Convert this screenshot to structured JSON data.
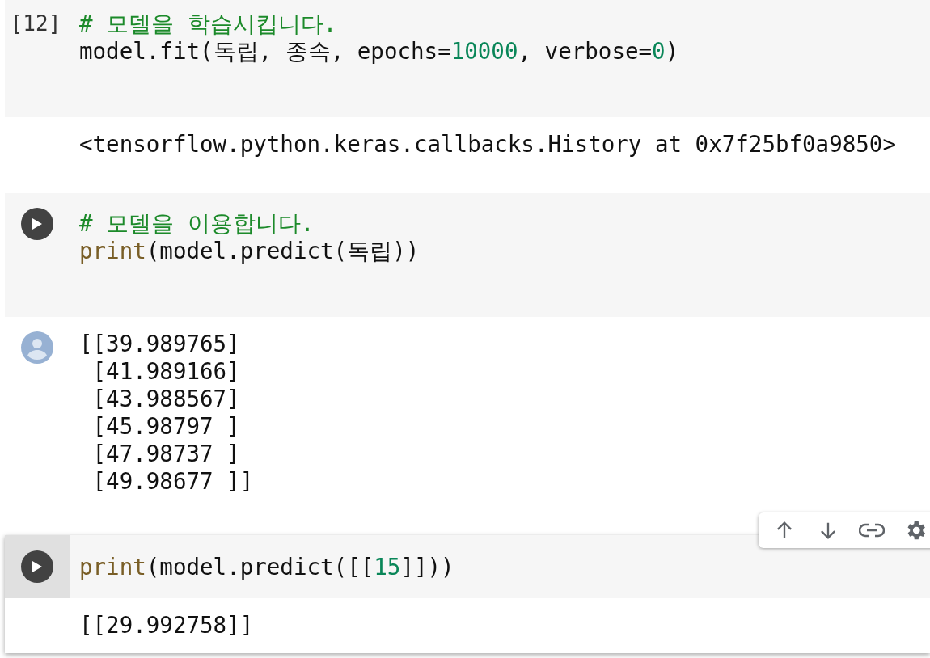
{
  "cells": [
    {
      "execution_count": "[12]",
      "focused": false,
      "output_icon": false,
      "code": [
        [
          {
            "kind": "comment",
            "text": "# 모델을 학습시킵니다."
          }
        ],
        [
          {
            "kind": "plain",
            "text": "model.fit(독립, 종속, epochs="
          },
          {
            "kind": "number",
            "text": "10000"
          },
          {
            "kind": "plain",
            "text": ", verbose="
          },
          {
            "kind": "number",
            "text": "0"
          },
          {
            "kind": "plain",
            "text": ")"
          }
        ]
      ],
      "output": [
        "<tensorflow.python.keras.callbacks.History at 0x7f25bf0a9850>"
      ]
    },
    {
      "focused": false,
      "output_icon": true,
      "code": [
        [
          {
            "kind": "comment",
            "text": "# 모델을 이용합니다."
          }
        ],
        [
          {
            "kind": "builtin",
            "text": "print"
          },
          {
            "kind": "plain",
            "text": "(model.predict(독립))"
          }
        ]
      ],
      "output": [
        "[[39.989765]",
        " [41.989166]",
        " [43.988567]",
        " [45.98797 ]",
        " [47.98737 ]",
        " [49.98677 ]]"
      ]
    },
    {
      "focused": true,
      "output_icon": false,
      "code": [
        [
          {
            "kind": "builtin",
            "text": "print"
          },
          {
            "kind": "plain",
            "text": "(model.predict([["
          },
          {
            "kind": "number",
            "text": "15"
          },
          {
            "kind": "plain",
            "text": "]]))"
          }
        ]
      ],
      "output": [
        "[[29.992758]]"
      ]
    }
  ]
}
